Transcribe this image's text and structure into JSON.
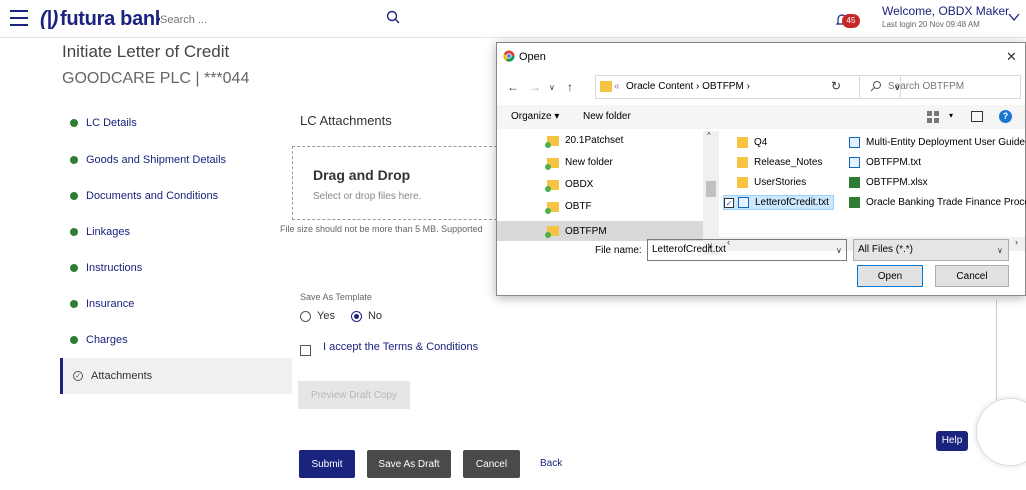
{
  "header": {
    "brand": "futura bank",
    "search_placeholder": "Search ...",
    "notification_count": "45",
    "welcome": "Welcome, OBDX Maker",
    "last_login": "Last login 20 Nov 09:48 AM"
  },
  "page": {
    "title": "Initiate Letter of Credit",
    "party": "GOODCARE PLC | ***044"
  },
  "nav": {
    "items": [
      {
        "label": "LC Details"
      },
      {
        "label": "Goods and Shipment Details"
      },
      {
        "label": "Documents and Conditions"
      },
      {
        "label": "Linkages"
      },
      {
        "label": "Instructions"
      },
      {
        "label": "Insurance"
      },
      {
        "label": "Charges"
      },
      {
        "label": "Attachments"
      }
    ]
  },
  "attachments": {
    "section_title": "LC Attachments",
    "drop_title": "Drag and Drop",
    "drop_sub": "Select or drop files here.",
    "file_note": "File size should not be more than 5 MB. Supported",
    "save_as_template": "Save As Template",
    "yes": "Yes",
    "no": "No",
    "terms": "I accept the Terms & Conditions",
    "preview": "Preview Draft Copy"
  },
  "actions": {
    "submit": "Submit",
    "save_draft": "Save As Draft",
    "cancel": "Cancel",
    "back": "Back",
    "help": "Help"
  },
  "dialog": {
    "title": "Open",
    "path_prefix": "«",
    "path": "Oracle Content  ›  OBTFPM  ›",
    "search_placeholder": "Search OBTFPM",
    "organize": "Organize ▾",
    "new_folder": "New folder",
    "tree": [
      "20.1Patchset",
      "New folder",
      "OBDX",
      "OBTF",
      "OBTFPM"
    ],
    "files_col1": [
      "Q4",
      "Release_Notes",
      "UserStories",
      "LetterofCredit.txt"
    ],
    "files_col2": [
      "Multi-Entity Deployment User Guide-",
      "OBTFPM.txt",
      "OBTFPM.xlsx",
      "Oracle Banking Trade Finance Process"
    ],
    "file_name_label": "File name:",
    "file_name_value": "LetterofCredit.txt",
    "filter": "All Files (*.*)",
    "open_btn": "Open",
    "cancel_btn": "Cancel"
  }
}
